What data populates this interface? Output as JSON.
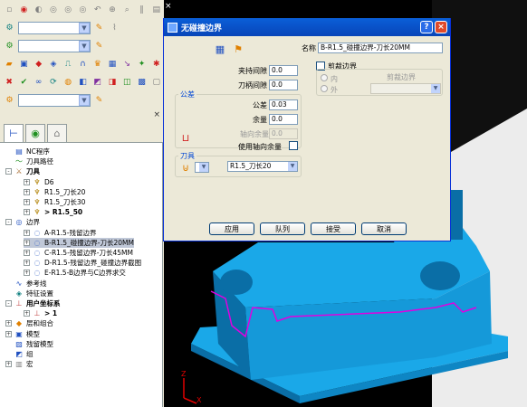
{
  "toolbar": {
    "row1_icons": [
      "new-icon",
      "open-icon",
      "save-icon",
      "copy-icon",
      "cut-icon",
      "paste-icon",
      "undo-icon",
      "redo-icon",
      "zoom-icon",
      "delete-icon"
    ],
    "row2_icon": "settings-icon",
    "row3_icons": [
      "open-folder-icon",
      "save-icon",
      "fill-icon",
      "boundary-icon",
      "path-icon",
      "tool-icon",
      "level-icon",
      "stock-icon",
      "arrow-icon",
      "transform-icon",
      "delete-icon"
    ],
    "row4_icons": [
      "cross-icon",
      "tick-icon",
      "chain-icon",
      "rotate-icon",
      "sim-icon",
      "view-icon",
      "cube-icon",
      "shade-icon",
      "wire-icon",
      "block-icon",
      "sheet-icon"
    ]
  },
  "panel": {
    "close_glyph": "×"
  },
  "tree": [
    {
      "label": "NC程序",
      "indent": 1,
      "icon": "nc-program-icon",
      "expander": "",
      "bold": false
    },
    {
      "label": "刀具路径",
      "indent": 1,
      "icon": "toolpath-icon",
      "expander": "",
      "bold": false
    },
    {
      "label": "刀具",
      "indent": 0,
      "icon": "tools-icon",
      "expander": "-",
      "bold": true
    },
    {
      "label": "D6",
      "indent": 2,
      "icon": "tool-item-icon",
      "expander": "+",
      "bold": false
    },
    {
      "label": "R1.5_刀长20",
      "indent": 2,
      "icon": "tool-item-icon",
      "expander": "+",
      "bold": false
    },
    {
      "label": "R1.5_刀长30",
      "indent": 2,
      "icon": "tool-item-icon",
      "expander": "+",
      "bold": false
    },
    {
      "label": "> R1.5_50",
      "indent": 2,
      "icon": "tool-item-icon",
      "expander": "+",
      "bold": true
    },
    {
      "label": "边界",
      "indent": 0,
      "icon": "boundary-icon",
      "expander": "-",
      "bold": false
    },
    {
      "label": "A-R1.5-残留边界",
      "indent": 2,
      "icon": "boundary-item-icon",
      "expander": "+",
      "bold": false
    },
    {
      "label": "B-R1.5_碰撞边界-刀长20MM",
      "indent": 2,
      "icon": "boundary-item-icon",
      "expander": "+",
      "bold": false,
      "selected": true
    },
    {
      "label": "C-R1.5-残留边界-刀长45MM",
      "indent": 2,
      "icon": "boundary-item-icon",
      "expander": "+",
      "bold": false
    },
    {
      "label": "D-R1.5-残留边界_碰撞边界截图",
      "indent": 2,
      "icon": "boundary-item-icon",
      "expander": "+",
      "bold": false
    },
    {
      "label": "E-R1.5-B边界与C边界求交",
      "indent": 2,
      "icon": "boundary-item-icon",
      "expander": "+",
      "bold": false
    },
    {
      "label": "参考线",
      "indent": 1,
      "icon": "pattern-icon",
      "expander": "",
      "bold": false
    },
    {
      "label": "特征设置",
      "indent": 1,
      "icon": "feature-icon",
      "expander": "",
      "bold": false
    },
    {
      "label": "用户坐标系",
      "indent": 0,
      "icon": "workplane-icon",
      "expander": "-",
      "bold": true
    },
    {
      "label": "> 1",
      "indent": 2,
      "icon": "workplane-item-icon",
      "expander": "+",
      "bold": true
    },
    {
      "label": "层和组合",
      "indent": 0,
      "icon": "levels-icon",
      "expander": "+",
      "bold": false
    },
    {
      "label": "模型",
      "indent": 0,
      "icon": "model-icon",
      "expander": "+",
      "bold": false
    },
    {
      "label": "残留模型",
      "indent": 1,
      "icon": "stock-model-icon",
      "expander": "",
      "bold": false
    },
    {
      "label": "组",
      "indent": 1,
      "icon": "group-icon",
      "expander": "",
      "bold": false
    },
    {
      "label": "宏",
      "indent": 0,
      "icon": "macro-icon",
      "expander": "+",
      "bold": false
    }
  ],
  "dialog": {
    "title": "无碰撞边界",
    "help_glyph": "?",
    "close_glyph": "×",
    "name_label": "名称",
    "name_value": "B-R1.5_碰撞边界-刀长20MM",
    "holder_clearance_label": "夹持间隙",
    "holder_clearance_value": "0.0",
    "shank_clearance_label": "刀柄间隙",
    "shank_clearance_value": "0.0",
    "tolerance_group": "公差",
    "tolerance_label": "公差",
    "tolerance_value": "0.03",
    "thickness_label": "余量",
    "thickness_value": "0.0",
    "axial_thickness_label": "轴向余量",
    "axial_thickness_value": "0.0",
    "use_axial_label": "使用轴向余量",
    "tool_group": "刀具",
    "tool_value": "R1.5_刀长20",
    "trim_boundary_label": "剪裁边界",
    "inside_label": "内",
    "outside_label": "外",
    "trim_boundary_combo_label": "剪裁边界",
    "buttons": {
      "apply": "应用",
      "queue": "队列",
      "accept": "接受",
      "cancel": "取消"
    }
  },
  "viewport": {
    "close_glyph": "×",
    "axis_z": "Z",
    "axis_x": "X"
  },
  "colors": {
    "model": "#1aa8e8",
    "model_shade": "#0a6ea6",
    "boundary": "#e000e0",
    "title_bar": "#0a5fd8",
    "background": "#000000"
  }
}
